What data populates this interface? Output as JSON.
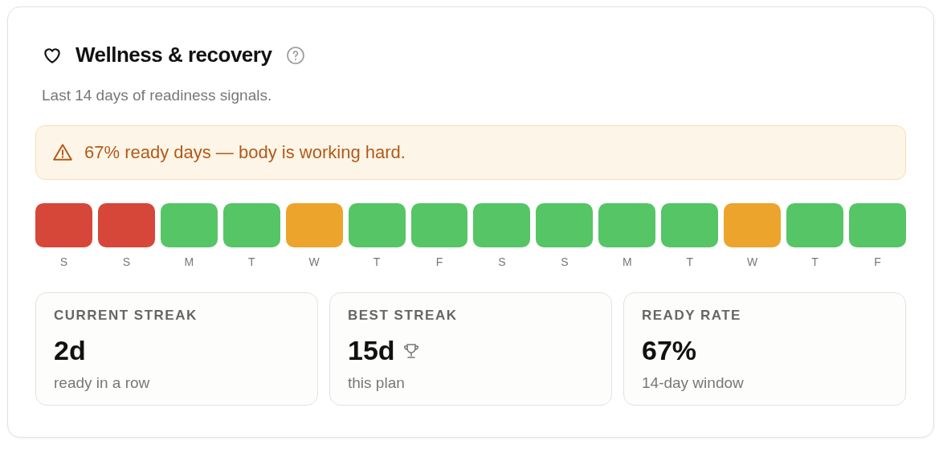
{
  "header": {
    "title": "Wellness & recovery",
    "subtitle": "Last 14 days of readiness signals."
  },
  "alert": {
    "text": "67% ready days — body is working hard."
  },
  "days": [
    {
      "label": "S",
      "color": "#d6473a"
    },
    {
      "label": "S",
      "color": "#d6473a"
    },
    {
      "label": "M",
      "color": "#55c566"
    },
    {
      "label": "T",
      "color": "#55c566"
    },
    {
      "label": "W",
      "color": "#eca42c"
    },
    {
      "label": "T",
      "color": "#55c566"
    },
    {
      "label": "F",
      "color": "#55c566"
    },
    {
      "label": "S",
      "color": "#55c566"
    },
    {
      "label": "S",
      "color": "#55c566"
    },
    {
      "label": "M",
      "color": "#55c566"
    },
    {
      "label": "T",
      "color": "#55c566"
    },
    {
      "label": "W",
      "color": "#eca42c"
    },
    {
      "label": "T",
      "color": "#55c566"
    },
    {
      "label": "F",
      "color": "#55c566"
    }
  ],
  "stats": [
    {
      "kind": "plain",
      "label": "CURRENT STREAK",
      "value": "2d",
      "caption": "ready in a row"
    },
    {
      "kind": "record",
      "label": "BEST STREAK",
      "value": "15d",
      "caption": "this plan"
    },
    {
      "kind": "plain",
      "label": "READY RATE",
      "value": "67%",
      "caption": "14-day window"
    }
  ]
}
